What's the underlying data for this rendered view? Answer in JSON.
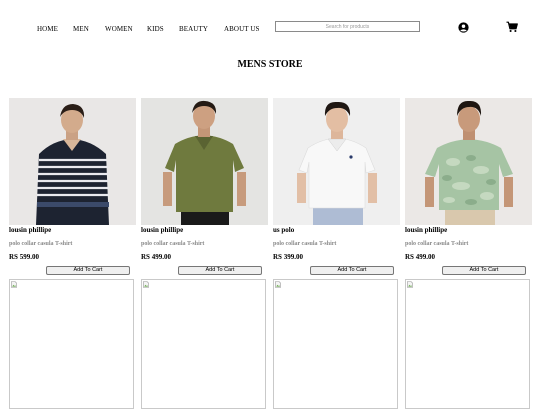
{
  "nav": {
    "links": [
      "HOME",
      "MEN",
      "WOMEN",
      "KIDS",
      "BEAUTY",
      "ABOUT US"
    ],
    "search_placeholder": "Search for products",
    "icons": [
      "user-icon",
      "cart-icon"
    ]
  },
  "page": {
    "title": "MENS STORE"
  },
  "products": [
    {
      "name": "lousin phillipe",
      "desc": "polo collar casula T-shirt",
      "price": "RS 599.00",
      "button": "Add To Cart",
      "image": "navy-white-striped-polo-sweater"
    },
    {
      "name": "lousin phillipe",
      "desc": "polo collar casula T-shirt",
      "price": "RS 499.00",
      "button": "Add To Cart",
      "image": "olive-green-polo-shirt"
    },
    {
      "name": "us polo",
      "desc": "polo collar casula T-shirt",
      "price": "RS 399.00",
      "button": "Add To Cart",
      "image": "white-polo-shirt"
    },
    {
      "name": "lousin phillipe",
      "desc": "polo collar casula T-shirt",
      "price": "RS 499.00",
      "button": "Add To Cart",
      "image": "green-tie-dye-tshirt"
    }
  ],
  "colors": {
    "text": "#000000",
    "muted": "#8a8a8a",
    "border": "#c9c9c9"
  }
}
